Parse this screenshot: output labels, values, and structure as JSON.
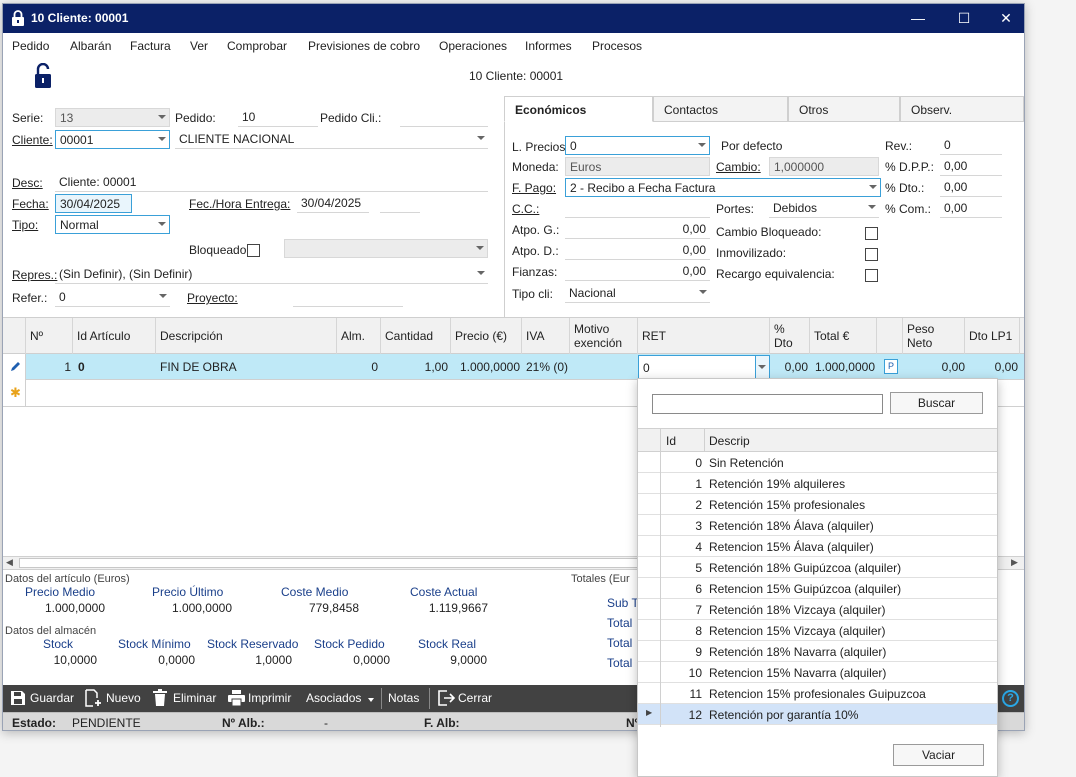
{
  "window": {
    "title": "10 Cliente: 00001",
    "minimize": "—",
    "maximize": "☐",
    "close": "✕"
  },
  "menu": [
    "Pedido",
    "Albarán",
    "Factura",
    "Ver",
    "Comprobar",
    "Previsiones de cobro",
    "Operaciones",
    "Informes",
    "Procesos"
  ],
  "header": {
    "doc_title": "10 Cliente: 00001"
  },
  "form": {
    "serie_label": "Serie:",
    "serie": "13",
    "pedido_label": "Pedido:",
    "pedido": "10",
    "pedido_cli_label": "Pedido Cli.:",
    "pedido_cli": "",
    "cliente_label": "Cliente:",
    "cliente_code": "00001",
    "cliente_name": "CLIENTE NACIONAL",
    "desc_label": "Desc:",
    "desc": "Cliente: 00001",
    "fecha_label": "Fecha:",
    "fecha": "30/04/2025",
    "entrega_label": "Fec./Hora Entrega:",
    "entrega": "30/04/2025",
    "tipo_label": "Tipo:",
    "tipo": "Normal",
    "bloqueado_label": "Bloqueado",
    "repres_label": "Repres.:",
    "repres": "(Sin Definir), (Sin Definir)",
    "refer_label": "Refer.:",
    "refer": "0",
    "proyecto_label": "Proyecto:",
    "proyecto": ""
  },
  "tabs": [
    "Económicos",
    "Contactos",
    "Otros",
    "Observ."
  ],
  "economicos": {
    "lprecios_label": "L. Precios",
    "lprecios": "0",
    "lprecios_desc": "Por defecto",
    "rev_label": "Rev.:",
    "rev": "0",
    "moneda_label": "Moneda:",
    "moneda": "Euros",
    "cambio_label": "Cambio:",
    "cambio": "1,000000",
    "dpp_label": "% D.P.P.:",
    "dpp": "0,00",
    "fpago_label": "F. Pago:",
    "fpago": "2 - Recibo a Fecha Factura",
    "dto_label": "% Dto.:",
    "dto": "0,00",
    "cc_label": "C.C.:",
    "cc": "",
    "portes_label": "Portes:",
    "portes": "Debidos",
    "com_label": "% Com.:",
    "com": "0,00",
    "atpog_label": "Atpo. G.:",
    "atpog": "0,00",
    "cambio_bloq_label": "Cambio Bloqueado:",
    "atpod_label": "Atpo. D.:",
    "atpod": "0,00",
    "inmov_label": "Inmovilizado:",
    "fianzas_label": "Fianzas:",
    "fianzas": "0,00",
    "recargo_label": "Recargo equivalencia:",
    "tipocli_label": "Tipo cli:",
    "tipocli": "Nacional"
  },
  "grid": {
    "columns": [
      "Nº",
      "Id Artículo",
      "Descripción",
      "Alm.",
      "Cantidad",
      "Precio (€)",
      "IVA",
      "Motivo exención",
      "RET",
      "% Dto",
      "Total €",
      "",
      "Peso Neto",
      "Dto LP1"
    ],
    "row": {
      "num": "1",
      "id": "0",
      "desc": "FIN DE OBRA",
      "alm": "0",
      "cantidad": "1,00",
      "precio": "1.000,0000",
      "iva": "21% (0)",
      "motivo": "",
      "ret": "0",
      "dto": "0,00",
      "total": "1.000,0000",
      "p": "P",
      "peso": "0,00",
      "dtolp1": "0,00"
    }
  },
  "articulo": {
    "section": "Datos del artículo (Euros)",
    "precio_medio_label": "Precio Medio",
    "precio_medio": "1.000,0000",
    "precio_ultimo_label": "Precio Último",
    "precio_ultimo": "1.000,0000",
    "coste_medio_label": "Coste Medio",
    "coste_medio": "779,8458",
    "coste_actual_label": "Coste Actual",
    "coste_actual": "1.119,9667"
  },
  "almacen": {
    "section": "Datos del almacén",
    "stock_label": "Stock",
    "stock": "10,0000",
    "minimo_label": "Stock Mínimo",
    "minimo": "0,0000",
    "reservado_label": "Stock Reservado",
    "reservado": "1,0000",
    "pedido_label": "Stock Pedido",
    "pedido": "0,0000",
    "real_label": "Stock Real",
    "real": "9,0000"
  },
  "totales": {
    "section": "Totales (Eur",
    "sub": "Sub T",
    "t1": "Total",
    "t2": "Total",
    "t3": "Total"
  },
  "toolbar": {
    "guardar": "Guardar",
    "nuevo": "Nuevo",
    "eliminar": "Eliminar",
    "imprimir": "Imprimir",
    "asociados": "Asociados",
    "notas": "Notas",
    "cerrar": "Cerrar"
  },
  "status": {
    "estado_label": "Estado:",
    "estado": "PENDIENTE",
    "alb_label": "Nº Alb.:",
    "alb": "-",
    "falb_label": "F. Alb:",
    "n_label": "Nº"
  },
  "popup": {
    "search_value": "",
    "buscar": "Buscar",
    "col_id": "Id",
    "col_desc": "Descrip",
    "items": [
      {
        "id": "0",
        "desc": "Sin Retención"
      },
      {
        "id": "1",
        "desc": "Retención 19% alquileres"
      },
      {
        "id": "2",
        "desc": "Retención 15% profesionales"
      },
      {
        "id": "3",
        "desc": "Retención 18% Álava (alquiler)"
      },
      {
        "id": "4",
        "desc": "Retencion 15% Álava (alquiler)"
      },
      {
        "id": "5",
        "desc": "Retención 18% Guipúzcoa (alquiler)"
      },
      {
        "id": "6",
        "desc": "Retencion 15% Guipúzcoa (alquiler)"
      },
      {
        "id": "7",
        "desc": "Retención 18% Vizcaya (alquiler)"
      },
      {
        "id": "8",
        "desc": "Retencion 15% Vizcaya (alquiler)"
      },
      {
        "id": "9",
        "desc": "Retención 18% Navarra (alquiler)"
      },
      {
        "id": "10",
        "desc": "Retencion 15% Navarra (alquiler)"
      },
      {
        "id": "11",
        "desc": "Retencion 15% profesionales Guipuzcoa"
      },
      {
        "id": "12",
        "desc": "Retención por garantía 10%"
      }
    ],
    "vaciar": "Vaciar"
  },
  "colors": {
    "titlebar": "#0b2167",
    "row_selected": "#bfe9f7",
    "focus_border": "#3aa0d8",
    "toolbar": "#424242"
  }
}
